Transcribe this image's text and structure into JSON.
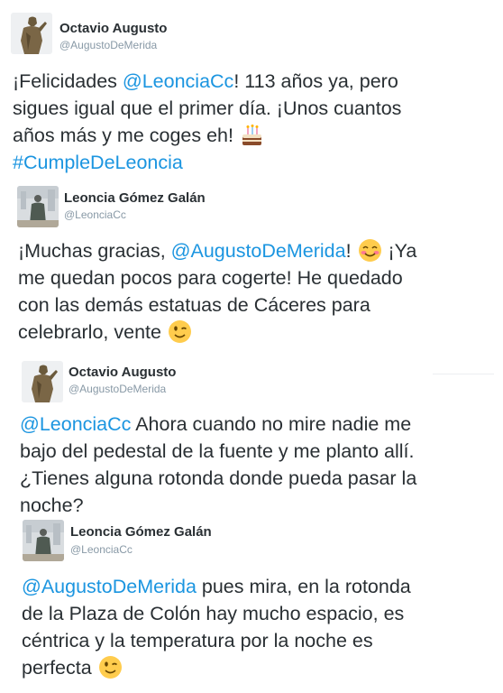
{
  "tweets": [
    {
      "author_name": "Octavio Augusto",
      "handle": "@AugustoDeMerida",
      "lines": [
        {
          "pre": "¡Felicidades ",
          "link": "@LeonciaCc",
          "post": "! 113 años ya, pero"
        },
        {
          "pre": "sigues igual que el primer día. ¡Unos cuantos"
        },
        {
          "pre": "años más y me coges eh! ",
          "emoji": "cake-icon"
        },
        {
          "link": "#CumpleDeLeoncia"
        }
      ]
    },
    {
      "author_name": "Leoncia Gómez Galán",
      "handle": "@LeonciaCc",
      "lines": [
        {
          "pre": "¡Muchas gracias, ",
          "link": "@AugustoDeMerida",
          "post": "! ",
          "emoji": "blushing-smile-icon",
          "post2": " ¡Ya"
        },
        {
          "pre": "me quedan pocos para cogerte! He quedado"
        },
        {
          "pre": "con las demás estatuas de Cáceres para"
        },
        {
          "pre": "celebrarlo, vente ",
          "emoji": "wink-icon"
        }
      ]
    },
    {
      "author_name": "Octavio Augusto",
      "handle": "@AugustoDeMerida",
      "lines": [
        {
          "link": "@LeonciaCc",
          "post": " Ahora cuando no mire nadie me"
        },
        {
          "pre": "bajo del pedestal de la fuente y me planto allí."
        },
        {
          "pre": "¿Tienes alguna rotonda donde pueda pasar la"
        },
        {
          "pre": "noche?"
        }
      ]
    },
    {
      "author_name": "Leoncia Gómez Galán",
      "handle": "@LeonciaCc",
      "lines": [
        {
          "link": "@AugustoDeMerida",
          "post": " pues mira, en la rotonda"
        },
        {
          "pre": "de la Plaza de Colón hay mucho espacio, es"
        },
        {
          "pre": "céntrica y la temperatura por la noche es"
        },
        {
          "pre": "perfecta ",
          "emoji": "wink-icon"
        }
      ]
    }
  ],
  "colors": {
    "link": "#1b95e0",
    "text": "#292f33",
    "handle": "#8899a6"
  }
}
